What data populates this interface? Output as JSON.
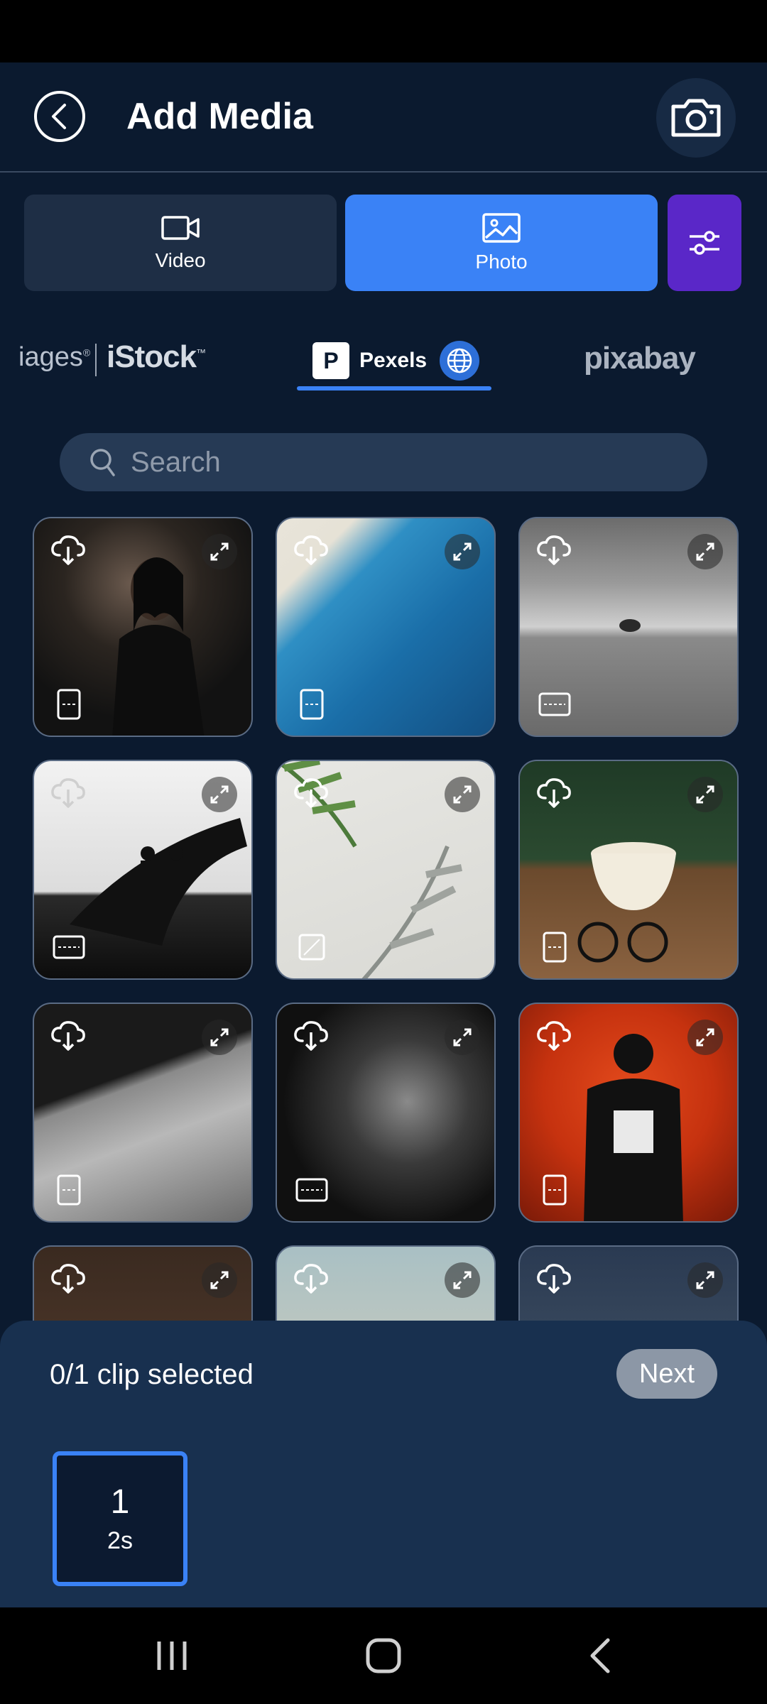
{
  "header": {
    "title": "Add Media"
  },
  "media_tabs": {
    "video_label": "Video",
    "photo_label": "Photo"
  },
  "sources": {
    "images_label": "iages",
    "images_mark": "®",
    "istock_label": "iStock",
    "istock_mark": "™",
    "pexels_logo": "P",
    "pexels_label": "Pexels",
    "pixabay_label": "pixabay"
  },
  "search": {
    "placeholder": "Search"
  },
  "grid": {
    "tiles": [
      {
        "id": "tile-1",
        "orientation": "portrait",
        "cloud_color": "#ffffff"
      },
      {
        "id": "tile-2",
        "orientation": "portrait",
        "cloud_color": "#ffffff"
      },
      {
        "id": "tile-3",
        "orientation": "landscape",
        "cloud_color": "#ffffff"
      },
      {
        "id": "tile-4",
        "orientation": "landscape",
        "cloud_color": "#cfcfcf"
      },
      {
        "id": "tile-5",
        "orientation": "square",
        "cloud_color": "#ffffff"
      },
      {
        "id": "tile-6",
        "orientation": "portrait",
        "cloud_color": "#ffffff"
      },
      {
        "id": "tile-7",
        "orientation": "portrait",
        "cloud_color": "#ffffff"
      },
      {
        "id": "tile-8",
        "orientation": "landscape",
        "cloud_color": "#ffffff"
      },
      {
        "id": "tile-9",
        "orientation": "portrait",
        "cloud_color": "#ffffff"
      },
      {
        "id": "tile-10",
        "orientation": "portrait",
        "cloud_color": "#ffffff"
      },
      {
        "id": "tile-11",
        "orientation": "portrait",
        "cloud_color": "#ffffff"
      },
      {
        "id": "tile-12",
        "orientation": "portrait",
        "cloud_color": "#ffffff"
      }
    ]
  },
  "selection": {
    "count_text": "0/1 clip selected",
    "next_label": "Next",
    "slot_number": "1",
    "slot_duration": "2s"
  },
  "colors": {
    "background": "#0b1a2f",
    "accent": "#3a82f6",
    "filter": "#5a27c8",
    "panel": "#18304f"
  }
}
